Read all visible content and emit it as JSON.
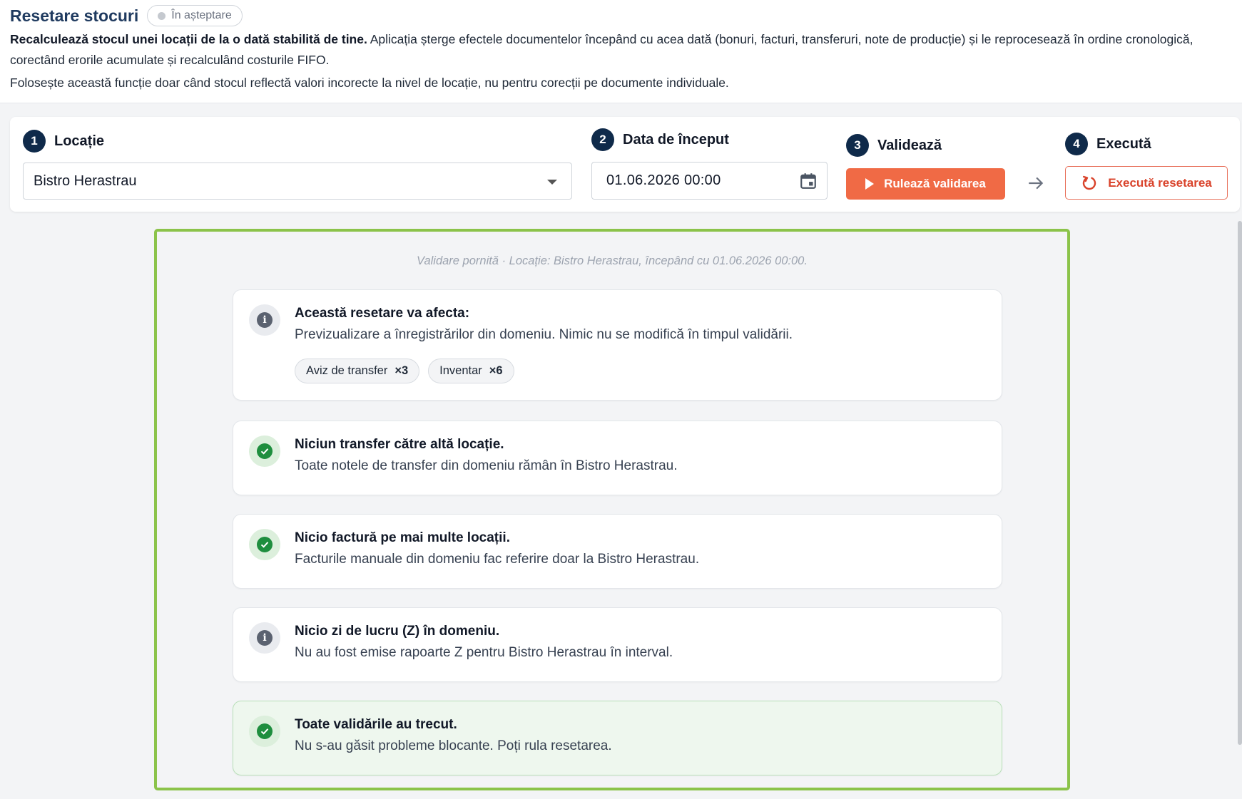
{
  "header": {
    "title": "Resetare stocuri",
    "status": "În așteptare",
    "description_bold": "Recalculează stocul unei locații de la o dată stabilită de tine.",
    "description_rest": " Aplicația șterge efectele documentelor începând cu acea dată (bonuri, facturi, transferuri, note de producție) și le reprocesează în ordine cronologică, corectând erorile acumulate și recalculând costurile FIFO.",
    "note": "Folosește această funcție doar când stocul reflectă valori incorecte la nivel de locație, nu pentru corecții pe documente individuale."
  },
  "steps": {
    "location": {
      "number": "1",
      "label": "Locație",
      "value": "Bistro Herastrau"
    },
    "start_date": {
      "number": "2",
      "label": "Data de început",
      "value": "01.06.2026 00:00"
    },
    "validate": {
      "number": "3",
      "label": "Validează",
      "button": "Rulează validarea"
    },
    "execute": {
      "number": "4",
      "label": "Execută",
      "button": "Execută resetarea"
    }
  },
  "results": {
    "note": "Validare pornită · Locație: Bistro Herastrau, începând cu 01.06.2026 00:00.",
    "cards": [
      {
        "kind": "info",
        "title": "Această resetare va afecta:",
        "text": "Previzualizare a înregistrărilor din domeniu. Nimic nu se modifică în timpul validării.",
        "chips": [
          {
            "label": "Aviz de transfer",
            "count": "×3"
          },
          {
            "label": "Inventar",
            "count": "×6"
          }
        ]
      },
      {
        "kind": "ok",
        "title": "Niciun transfer către altă locație.",
        "text": "Toate notele de transfer din domeniu rămân în Bistro Herastrau."
      },
      {
        "kind": "ok",
        "title": "Nicio factură pe mai multe locații.",
        "text": "Facturile manuale din domeniu fac referire doar la Bistro Herastrau."
      },
      {
        "kind": "info",
        "title": "Nicio zi de lucru (Z) în domeniu.",
        "text": "Nu au fost emise rapoarte Z pentru Bistro Herastrau în interval."
      },
      {
        "kind": "ok",
        "title": "Toate validările au trecut.",
        "text": "Nu s-au găsit probleme blocante. Poți rula resetarea."
      }
    ]
  },
  "colors": {
    "accent": "#f06a45",
    "danger": "#d9432b",
    "navy": "#0f2a4a",
    "success": "#1e8e3e",
    "panel_border": "#8bc34a"
  }
}
